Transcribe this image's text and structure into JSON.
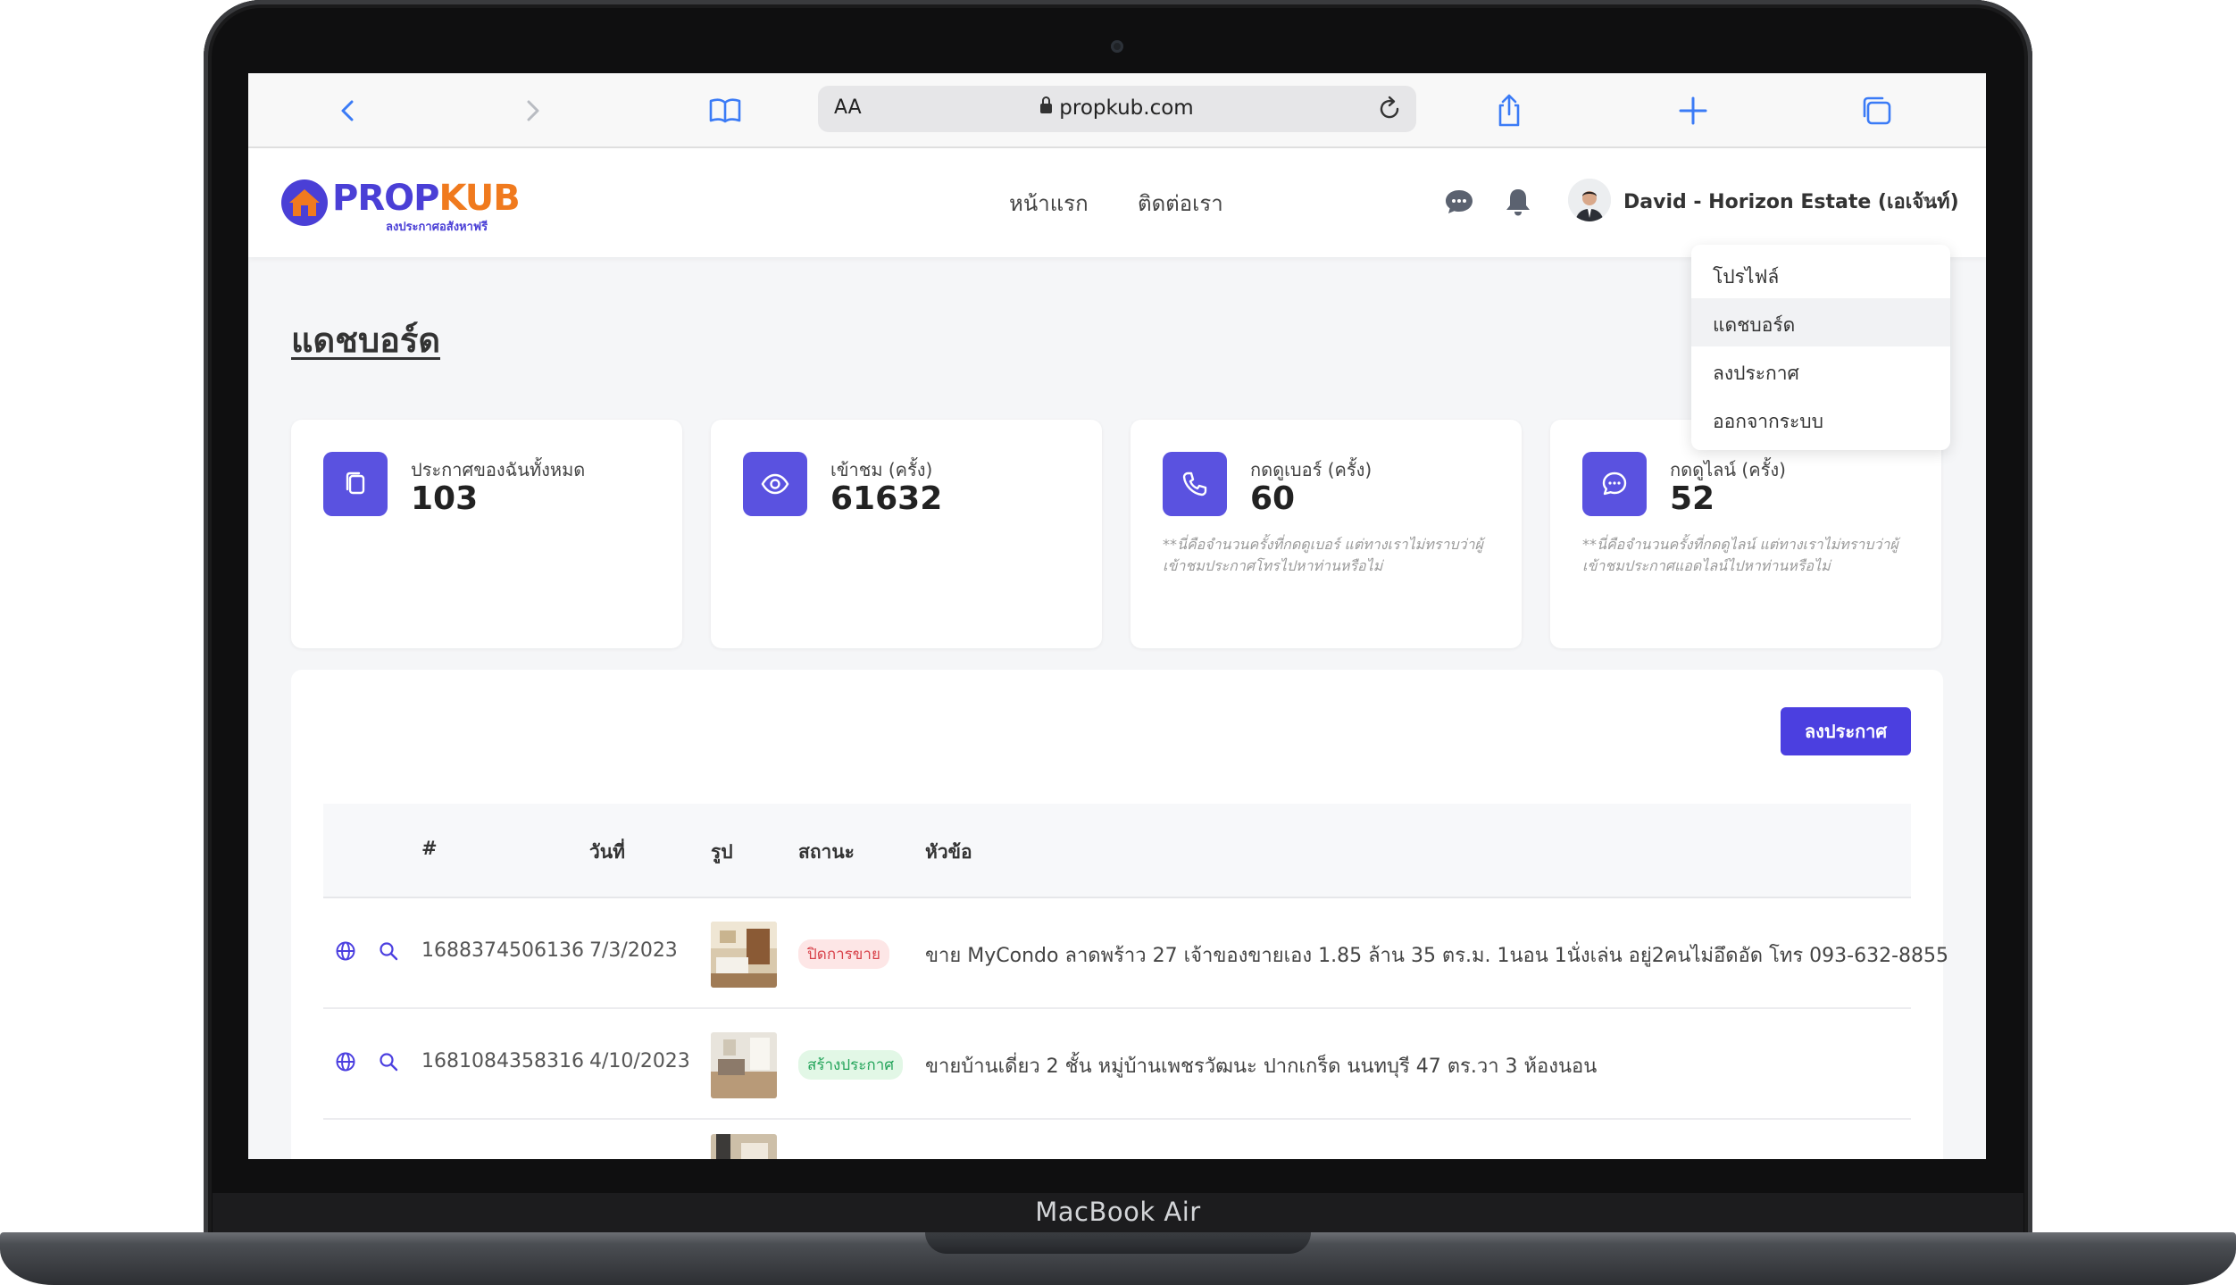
{
  "device": {
    "label": "MacBook Air"
  },
  "browser": {
    "text_size_label": "AA",
    "url": "propkub.com"
  },
  "site": {
    "logo": {
      "brand_part1": "PROP",
      "brand_part2": "KUB",
      "tagline": "ลงประกาศอสังหาฟรี"
    },
    "nav": [
      {
        "label": "หน้าแรก"
      },
      {
        "label": "ติดต่อเรา"
      }
    ],
    "user": {
      "name": "David - Horizon Estate (เอเจ้นท์)"
    }
  },
  "dropdown": {
    "items": [
      {
        "label": "โปรไฟล์"
      },
      {
        "label": "แดชบอร์ด"
      },
      {
        "label": "ลงประกาศ"
      },
      {
        "label": "ออกจากระบบ"
      }
    ]
  },
  "page": {
    "title": "แดชบอร์ด"
  },
  "stats": [
    {
      "label": "ประกาศของฉันทั้งหมด",
      "value": "103",
      "note": ""
    },
    {
      "label": "เข้าชม (ครั้ง)",
      "value": "61632",
      "note": ""
    },
    {
      "label": "กดดูเบอร์ (ครั้ง)",
      "value": "60",
      "note": "**นี่คือจำนวนครั้งที่กดดูเบอร์ แต่ทางเราไม่ทราบว่าผู้เข้าชมประกาศโทรไปหาท่านหรือไม่"
    },
    {
      "label": "กดดูไลน์ (ครั้ง)",
      "value": "52",
      "note": "**นี่คือจำนวนครั้งที่กดดูไลน์ แต่ทางเราไม่ทราบว่าผู้เข้าชมประกาศแอดไลน์ไปหาท่านหรือไม่"
    }
  ],
  "table": {
    "post_button": "ลงประกาศ",
    "headers": {
      "id": "#",
      "date": "วันที่",
      "image": "รูป",
      "status": "สถานะ",
      "title": "หัวข้อ"
    },
    "rows": [
      {
        "id": "1688374506136",
        "date": "7/3/2023",
        "status": "ปิดการขาย",
        "status_type": "closed",
        "title": "ขาย MyCondo ลาดพร้าว 27 เจ้าของขายเอง 1.85 ล้าน 35 ตร.ม. 1นอน 1นั่งเล่น อยู่2คนไม่อึดอัด โทร 093-632-8855"
      },
      {
        "id": "1681084358316",
        "date": "4/10/2023",
        "status": "สร้างประกาศ",
        "status_type": "created",
        "title": "ขายบ้านเดี่ยว 2 ชั้น หมู่บ้านเพชรวัฒนะ ปากเกร็ด นนทบุรี 47 ตร.วา 3 ห้องนอน"
      }
    ]
  },
  "colors": {
    "accent": "#4b3fe0",
    "brand_orange": "#f07a1e",
    "closed": "#d8424a",
    "created": "#23a45a"
  }
}
